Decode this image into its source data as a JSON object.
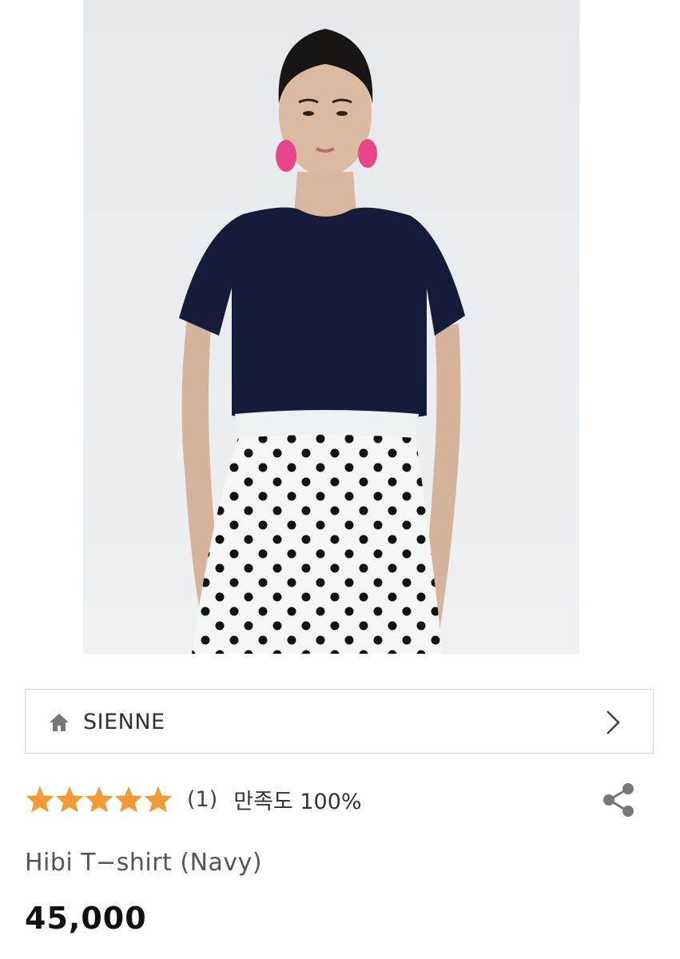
{
  "product_image": {
    "icon": "product-photo"
  },
  "brand": {
    "name": "SIENNE",
    "icon": "home-icon",
    "link_icon": "chevron-right-icon"
  },
  "rating": {
    "stars": 5,
    "max_stars": 5,
    "review_count": "(1)",
    "satisfaction": "만족도 100%",
    "star_color": "#f29a35"
  },
  "share": {
    "icon": "share-icon"
  },
  "product": {
    "name": "Hibi T−shirt (Navy)",
    "price": "45,000"
  }
}
